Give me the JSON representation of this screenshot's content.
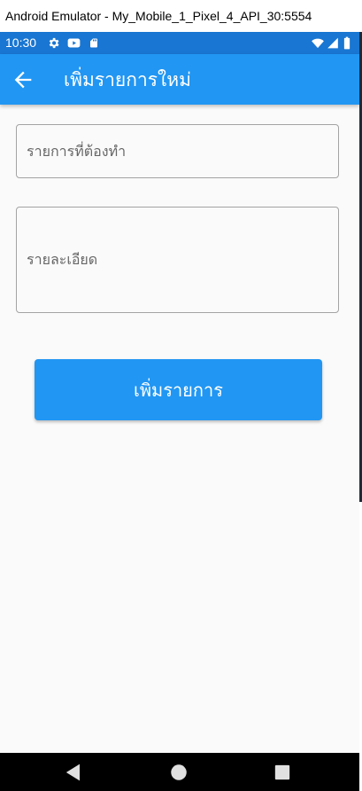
{
  "window": {
    "title": "Android Emulator - My_Mobile_1_Pixel_4_API_30:5554"
  },
  "status_bar": {
    "time": "10:30",
    "left_icons": [
      "gear-icon",
      "youtube-icon",
      "sd-card-icon"
    ],
    "right_icons": [
      "wifi-icon",
      "cell-signal-icon",
      "battery-icon"
    ]
  },
  "app_bar": {
    "title": "เพิ่มรายการใหม่",
    "back_icon": "arrow-left-icon"
  },
  "form": {
    "title_placeholder": "รายการที่ต้องทำ",
    "detail_placeholder": "รายละเอียด",
    "submit_label": "เพิ่มรายการ"
  },
  "nav_bar": {
    "icons": [
      "back-triangle-icon",
      "home-circle-icon",
      "recents-square-icon"
    ]
  },
  "colors": {
    "status_bar": "#1976d2",
    "app_bar": "#2196f3",
    "button": "#2196f3",
    "background": "#fafafa",
    "nav_bar": "#000000"
  }
}
